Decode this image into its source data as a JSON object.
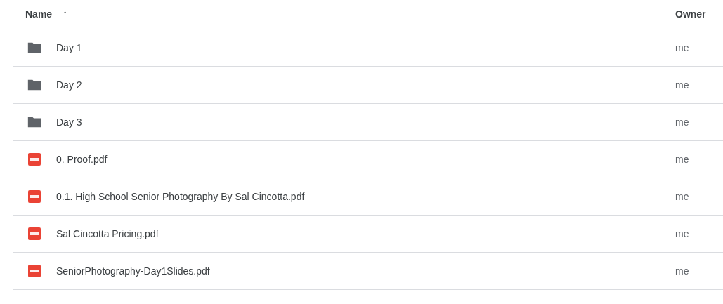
{
  "columns": [
    {
      "label": "Name",
      "sort_arrow": "↑"
    },
    {
      "label": "Owner"
    }
  ],
  "rows": [
    {
      "kind": "folder",
      "name": "Day 1",
      "owner": "me"
    },
    {
      "kind": "folder",
      "name": "Day 2",
      "owner": "me"
    },
    {
      "kind": "folder",
      "name": "Day 3",
      "owner": "me"
    },
    {
      "kind": "pdf",
      "name": "0. Proof.pdf",
      "owner": "me"
    },
    {
      "kind": "pdf",
      "name": "0.1. High School Senior Photography By Sal Cincotta.pdf",
      "owner": "me"
    },
    {
      "kind": "pdf",
      "name": "Sal Cincotta Pricing.pdf",
      "owner": "me"
    },
    {
      "kind": "pdf",
      "name": "SeniorPhotography-Day1Slides.pdf",
      "owner": "me"
    }
  ]
}
